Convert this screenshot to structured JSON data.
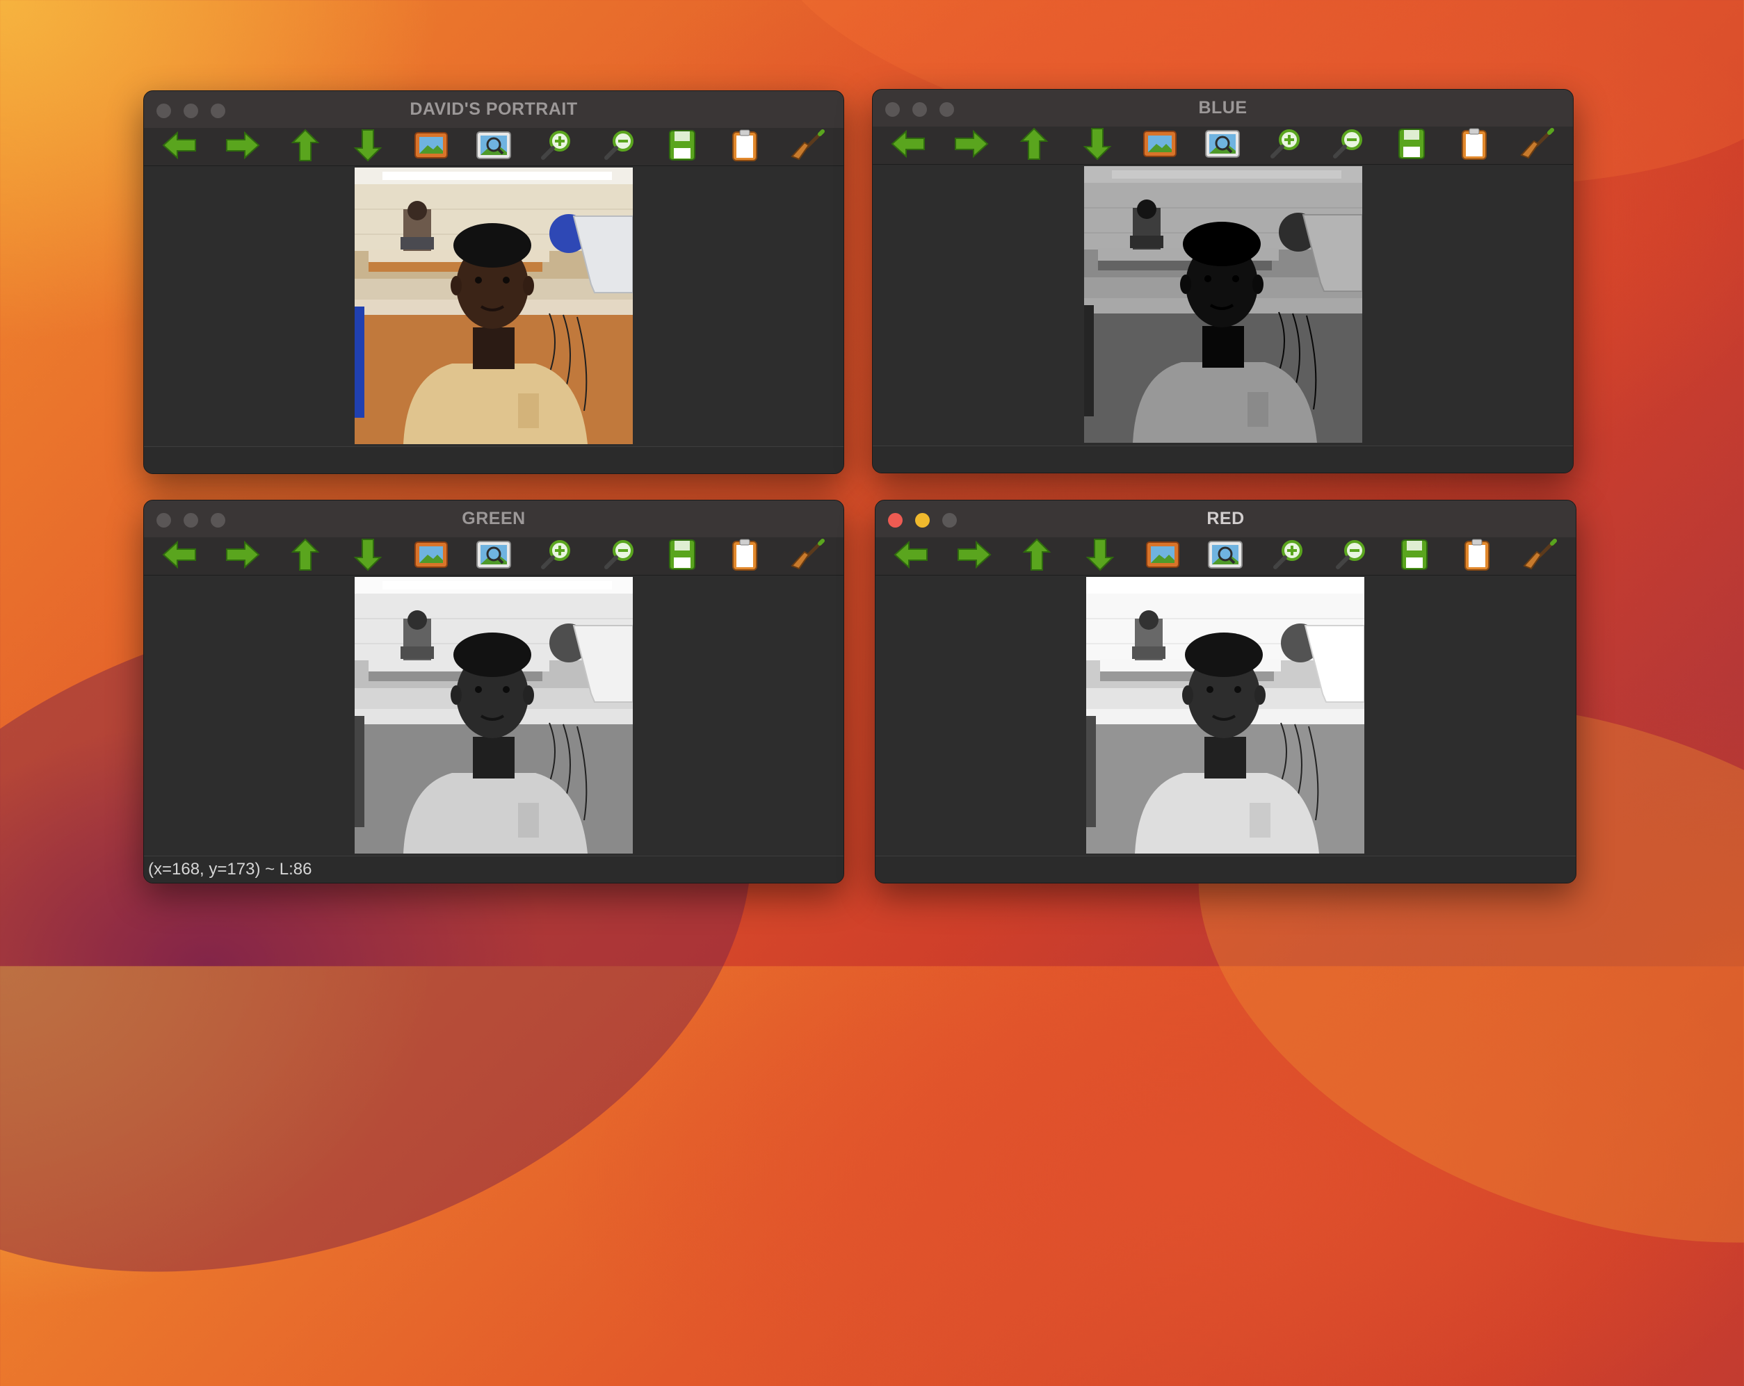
{
  "windows": [
    {
      "title": "DAVID'S PORTRAIT",
      "status": ""
    },
    {
      "title": "BLUE",
      "status": ""
    },
    {
      "title": "GREEN",
      "status": "(x=168, y=173) ~ L:86"
    },
    {
      "title": "RED",
      "status": ""
    }
  ],
  "toolbar_icons": [
    "arrow-left-icon",
    "arrow-right-icon",
    "arrow-up-icon",
    "arrow-down-icon",
    "image-icon",
    "zoom-fit-icon",
    "zoom-in-icon",
    "zoom-out-icon",
    "save-icon",
    "clipboard-icon",
    "broom-icon"
  ],
  "colors": {
    "icon_green": "#5aa51e",
    "window_bg": "#2c2c2c",
    "close_red": "#ee5b52",
    "minimize_yellow": "#f0b92d"
  }
}
